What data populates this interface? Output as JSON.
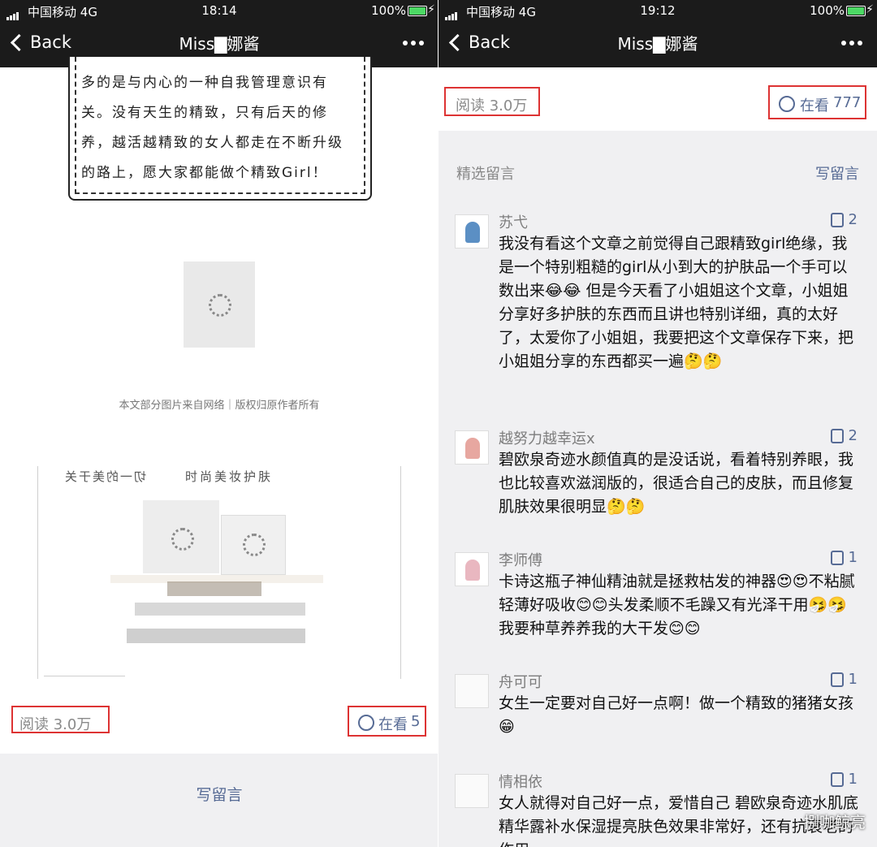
{
  "left": {
    "status": {
      "carrier": "中国移动",
      "network": "4G",
      "time": "18:14",
      "battery": "100%"
    },
    "nav": {
      "back": "Back",
      "title": "Miss▇娜酱"
    },
    "article_text": "多的是与内心的一种自我管理意识有关。没有天生的精致，只有后天的修养，越活越精致的女人都走在不断升级的路上，愿大家都能做个精致Girl！",
    "credit": "本文部分图片来自网络｜版权归原作者所有",
    "poster": {
      "text_left": "切一的美于关",
      "text_right": "时尚美妆护肤"
    },
    "read": "阅读 3.0万",
    "look_label": "在看",
    "look_count": "5",
    "write_comment": "写留言"
  },
  "right": {
    "status": {
      "carrier": "中国移动",
      "network": "4G",
      "time": "19:12",
      "battery": "100%"
    },
    "nav": {
      "back": "Back",
      "title": "Miss▇娜酱"
    },
    "read": "阅读 3.0万",
    "look_label": "在看",
    "look_count": "777",
    "section_title": "精选留言",
    "write_comment": "写留言",
    "comments": [
      {
        "name": "苏弋",
        "likes": "2",
        "text": "我没有看这个文章之前觉得自己跟精致girl绝缘，我是一个特别粗糙的girl从小到大的护肤品一个手可以数出来😂😂 但是今天看了小姐姐这个文章，小姐姐分享好多护肤的东西而且讲也特别详细，真的太好了，太爱你了小姐姐，我要把这个文章保存下来，把小姐姐分享的东西都买一遍🤔🤔"
      },
      {
        "name": "越努力越幸运x",
        "likes": "2",
        "text": "碧欧泉奇迹水颜值真的是没话说，看着特别养眼，我也比较喜欢滋润版的，很适合自己的皮肤，而且修复肌肤效果很明显🤔🤔"
      },
      {
        "name": "李师傅",
        "likes": "1",
        "text": "卡诗这瓶子神仙精油就是拯救枯发的神器😍😍不粘腻轻薄好吸收😊😊头发柔顺不毛躁又有光泽干用🤧🤧我要种草养养我的大干发😊😊"
      },
      {
        "name": "舟可可",
        "likes": "1",
        "text": "女生一定要对自己好一点啊！做一个精致的猪猪女孩😁"
      },
      {
        "name": "情相依",
        "likes": "1",
        "text": "女人就得对自己好一点，爱惜自己 碧欧泉奇迹水肌底精华露补水保湿提亮肤色效果非常好，还有抗衰老的作用…"
      }
    ],
    "watermark": "捌咖鲸亮"
  }
}
